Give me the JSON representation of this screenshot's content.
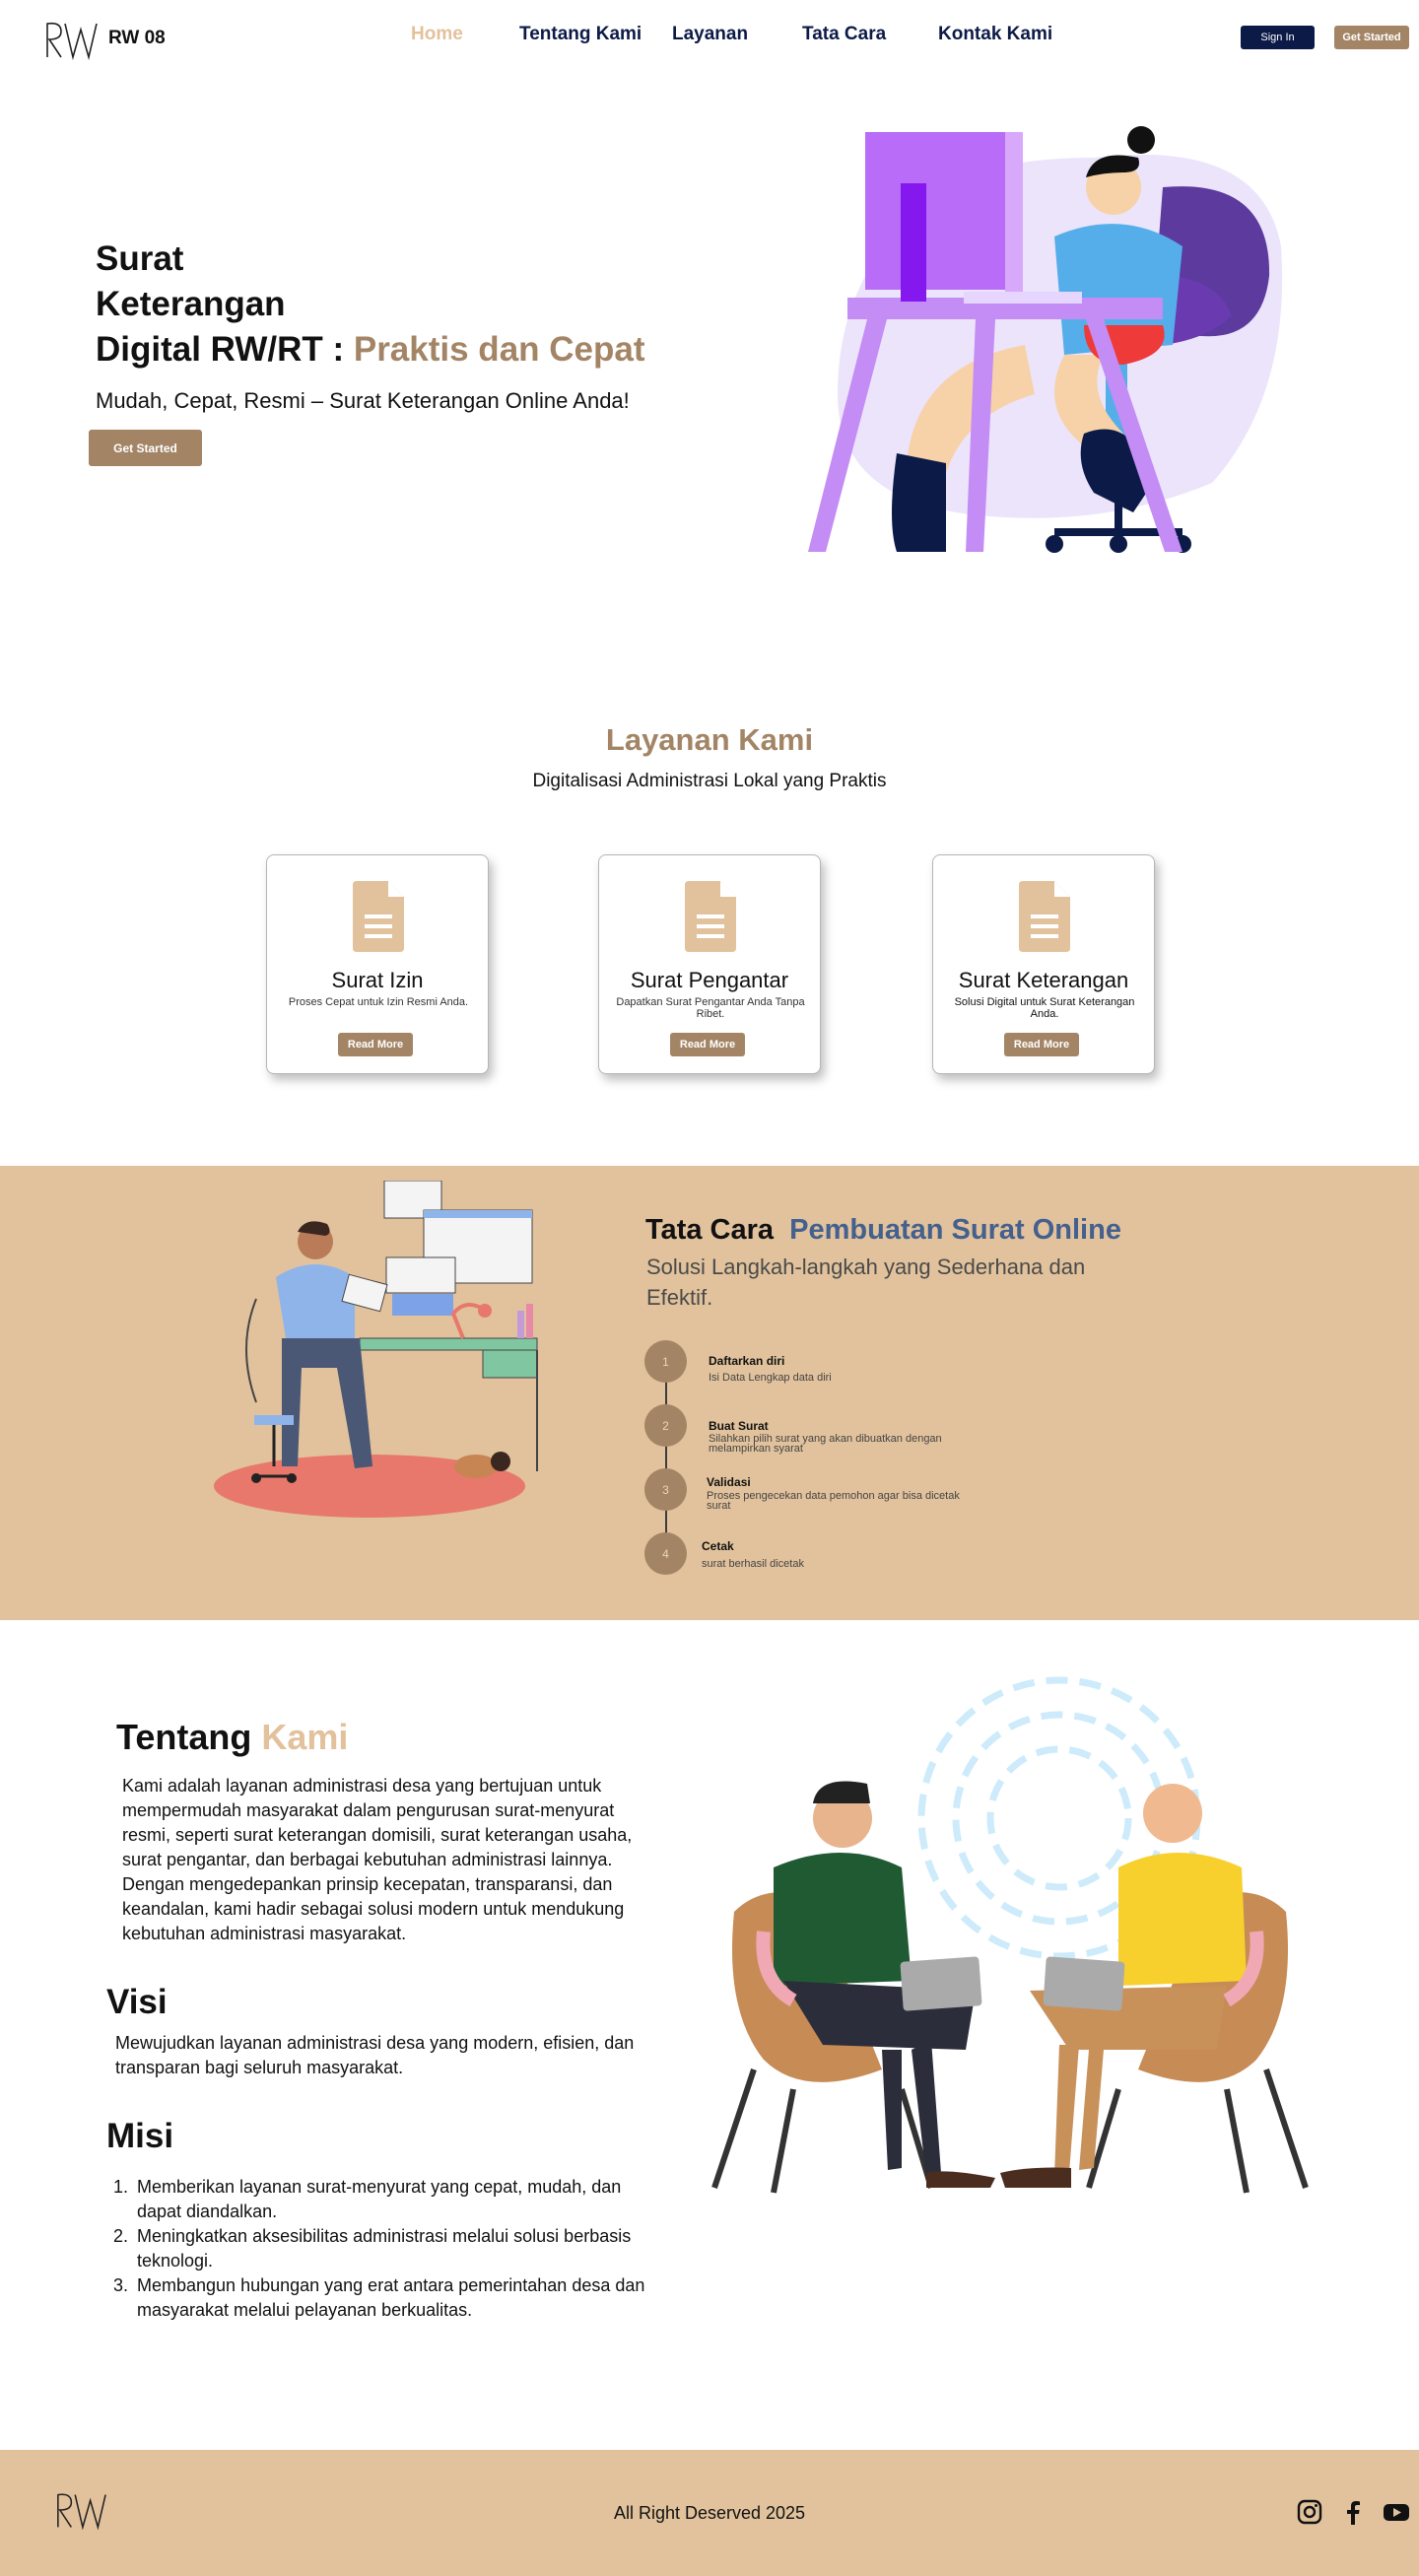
{
  "nav": {
    "brand": "RW 08",
    "links": [
      "Home",
      "Tentang Kami",
      "Layanan",
      "Tata Cara",
      "Kontak Kami"
    ],
    "signin_label": "Sign In",
    "getstarted_label": "Get Started"
  },
  "hero": {
    "title_line1": "Surat",
    "title_line2": "Keterangan",
    "title_line3": "Digital RW/RT :",
    "title_accent": "Praktis dan Cepat",
    "subtitle": "Mudah, Cepat, Resmi – Surat Keterangan Online Anda!",
    "button_label": "Get Started"
  },
  "layanan": {
    "title": "Layanan Kami",
    "subtitle": "Digitalisasi Administrasi Lokal yang Praktis",
    "cards": [
      {
        "title": "Surat Izin",
        "desc": "Proses Cepat untuk Izin Resmi Anda.",
        "button": "Read More"
      },
      {
        "title": "Surat Pengantar",
        "desc": "Dapatkan Surat Pengantar Anda Tanpa Ribet.",
        "button": "Read More"
      },
      {
        "title": "Surat Keterangan",
        "desc": "Solusi Digital untuk Surat Keterangan Anda.",
        "button": "Read More"
      }
    ]
  },
  "tata_cara": {
    "title": "Tata Cara",
    "title_accent": "Pembuatan Surat Online",
    "subtitle": "Solusi Langkah-langkah yang Sederhana dan Efektif.",
    "steps": [
      {
        "num": "1",
        "title": "Daftarkan diri",
        "desc": "Isi Data Lengkap data diri"
      },
      {
        "num": "2",
        "title": "Buat Surat",
        "desc": "Silahkan pilih surat yang akan dibuatkan dengan melampirkan syarat"
      },
      {
        "num": "3",
        "title": "Validasi",
        "desc": "Proses pengecekan data pemohon agar bisa dicetak surat"
      },
      {
        "num": "4",
        "title": "Cetak",
        "desc": "surat berhasil dicetak"
      }
    ]
  },
  "tentang": {
    "title": "Tentang",
    "title_accent": "Kami",
    "body": "Kami adalah layanan administrasi desa yang bertujuan untuk mempermudah masyarakat dalam pengurusan surat-menyurat resmi, seperti surat keterangan domisili, surat keterangan usaha, surat pengantar, dan berbagai kebutuhan administrasi lainnya. Dengan mengedepankan prinsip kecepatan, transparansi, dan keandalan, kami hadir sebagai solusi modern untuk mendukung kebutuhan administrasi masyarakat.",
    "visi_title": "Visi",
    "visi_body": "Mewujudkan layanan administrasi desa yang modern, efisien, dan transparan bagi seluruh masyarakat.",
    "misi_title": "Misi",
    "misi_items": [
      "Memberikan layanan surat-menyurat yang cepat, mudah, dan dapat diandalkan.",
      "Meningkatkan aksesibilitas administrasi melalui solusi berbasis teknologi.",
      "Membangun hubungan yang erat antara pemerintahan desa dan masyarakat melalui pelayanan berkualitas."
    ]
  },
  "footer": {
    "copyright": "All Right Deserved 2025",
    "socials": [
      "instagram-icon",
      "facebook-icon",
      "youtube-icon"
    ]
  },
  "colors": {
    "accent_brown": "#a38566",
    "accent_tan": "#e1c29c",
    "navy": "#0c1a47",
    "blue_accent": "#43608e"
  }
}
